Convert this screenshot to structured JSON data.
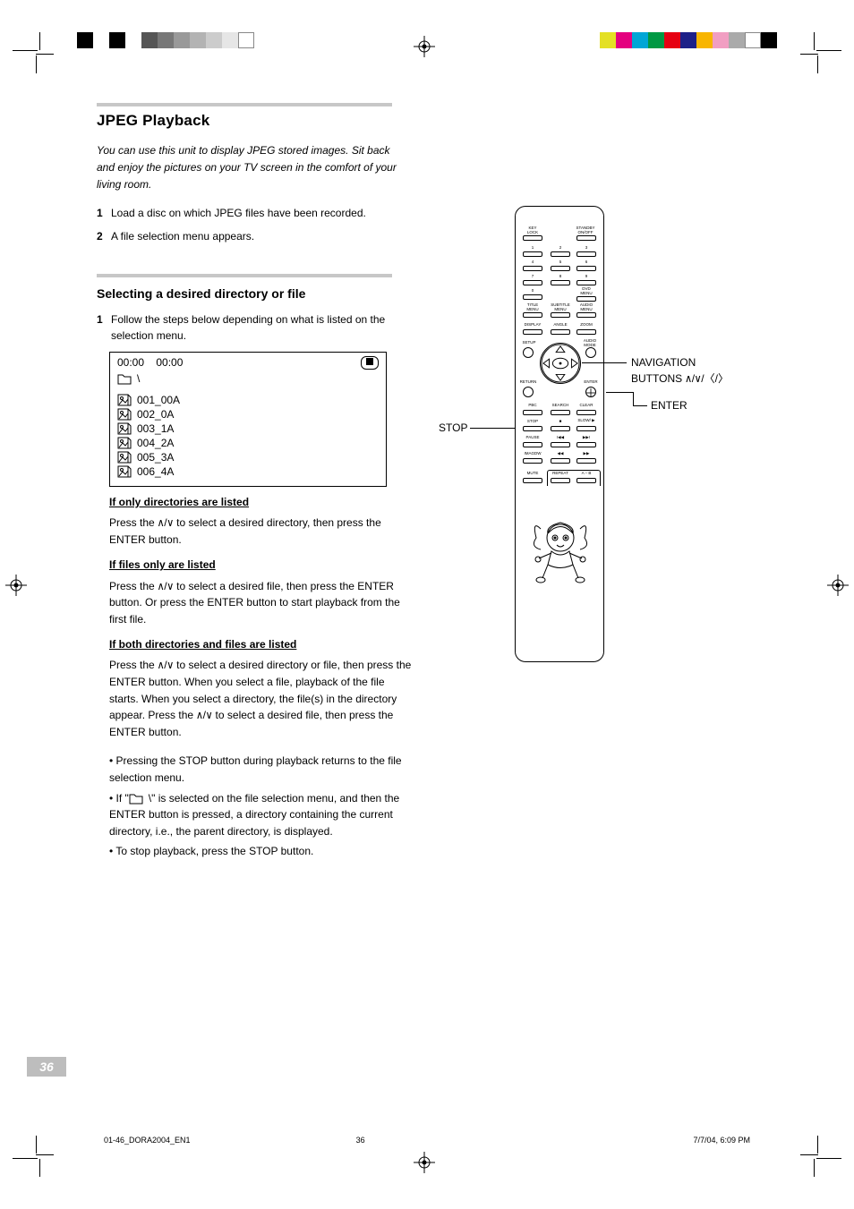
{
  "swatches_left": [
    "#000000",
    "#ffffff",
    "#000000",
    "#ffffff",
    "#555555",
    "#777777",
    "#999999",
    "#b3b3b3",
    "#cccccc",
    "#e6e6e6",
    "#ffffff"
  ],
  "swatches_right": [
    "#e4e024",
    "#e4007f",
    "#00a6d6",
    "#009944",
    "#e60012",
    "#1d2088",
    "#f8b500",
    "#f19ec2",
    "#aaaaaa",
    "#ffffff",
    "#000000"
  ],
  "section": {
    "title": "JPEG Playback",
    "intro": "You can use this unit to display JPEG stored images. Sit back and enjoy the pictures on your TV screen in the comfort of your living room.",
    "step1_num": "1",
    "step1": "Load a disc on which JPEG files have been recorded.",
    "step2_num": "2",
    "step2": "A file selection menu appears.",
    "sub_title": "Selecting a desired directory or file",
    "step_sub_num": "1",
    "step_sub": "Follow the steps below depending on what is listed on the selection menu.",
    "case_dirs_only_label": "If only directories are listed",
    "case_dirs_only": "Press the  / to select a desired directory, then press the ENTER button.",
    "case_files_only_label": "If files only are listed",
    "case_files_only": "Press the  /  to select a desired file, then press the ENTER button. Or press the ENTER button to start playback from the first file.",
    "case_both_label": "If both directories and files are listed",
    "case_both": "Press the  /  to select a desired directory or file, then press the ENTER button. When you select a file, playback of the file starts. When you select a directory, the file(s) in the directory appear. Press the  /  to select a desired file, then press the ENTER button.",
    "bullet1": "• Pressing the STOP button during playback returns to the file selection menu.",
    "bullet2": "• If \"   \\\" is selected on the file selection menu, and then the ENTER button is pressed, a directory containing the current directory, i.e., the parent directory, is displayed.",
    "bullet3": "• To stop playback, press the STOP button."
  },
  "filebox": {
    "time1": "00:00",
    "time2": "00:00",
    "root": "\\",
    "files": [
      "001_00A",
      "002_0A",
      "003_1A",
      "004_2A",
      "005_3A",
      "006_4A"
    ]
  },
  "remote": {
    "labels": {
      "key_lock": "KEY\nLOCK",
      "standby": "STANDBY\nON/OFF",
      "n1": "1",
      "n2": "2",
      "n3": "3",
      "n4": "4",
      "n5": "5",
      "n6": "6",
      "n7": "7",
      "n8": "8",
      "n9": "9",
      "n0": "0",
      "dvd_menu": "DVD\nMENU",
      "title_menu": "TITLE\nMENU",
      "subtitle_menu": "SUBTITLE\nMENU",
      "audio_menu": "AUDIO\nMENU",
      "display": "DISPLAY",
      "angle": "ANGLE",
      "zoom": "ZOOM",
      "setup": "SETUP",
      "audio_mode": "AUDIO\nMODE",
      "return": "RETURN",
      "enter": "ENTER",
      "pbc": "PBC",
      "search": "SEARCH",
      "clear": "CLEAR",
      "stop": "STOP",
      "stop_sym": "■",
      "slow": "SLOW/\n▶",
      "pause": "PAUSE",
      "prev": "I◀◀",
      "next": "▶▶I",
      "imagdw": "IMAGDW",
      "rew": "◀◀",
      "ff": "▶▶",
      "mute": "MUTE",
      "repeat": "REPEAT",
      "ab": "A – B"
    }
  },
  "callouts": {
    "nav": "NAVIGATION",
    "nav2": "BUTTONS  / / / ",
    "enter": "ENTER",
    "stop": "STOP"
  },
  "page_number": "36",
  "footer_file": "01-46_DORA2004_EN1",
  "footer_page": "36",
  "footer_ts": "7/7/04, 6:09 PM"
}
